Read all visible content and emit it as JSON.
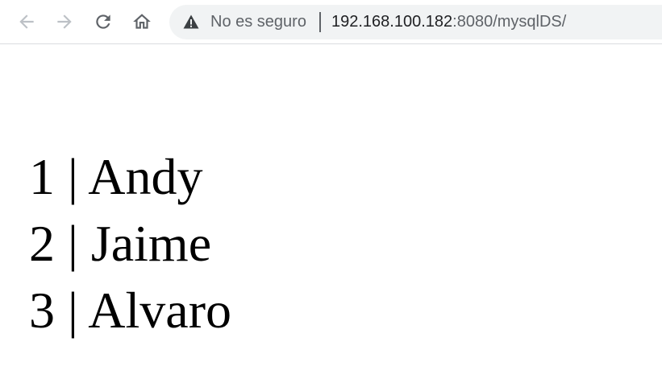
{
  "browser": {
    "security_label": "No es seguro",
    "url_host": "192.168.100.182",
    "url_rest": ":8080/mysqlDS/"
  },
  "rows": [
    {
      "id": "1",
      "name": "Andy"
    },
    {
      "id": "2",
      "name": "Jaime"
    },
    {
      "id": "3",
      "name": "Alvaro"
    }
  ],
  "separator": "|"
}
